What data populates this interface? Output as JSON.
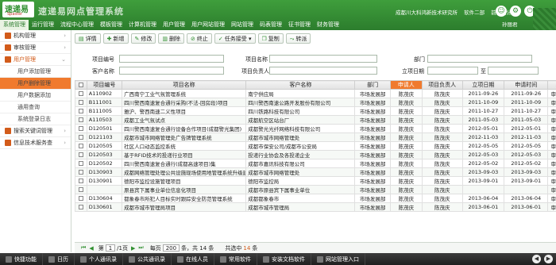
{
  "logo": {
    "brand": "速递易",
    "sub": "Spaster"
  },
  "app": {
    "title": "速递易网点管理系统",
    "company": "成都川大科鸿新技术研究所",
    "dept": "软件二部",
    "role": "前端设计",
    "user": "孙丽君"
  },
  "menus": [
    "系统管理",
    "运行管理",
    "流程中心管理",
    "模板管理",
    "计算机管理",
    "用户管理",
    "用户网站管理",
    "网站管理",
    "码表管理",
    "征书管理",
    "财务管理"
  ],
  "sidebar": {
    "items": [
      {
        "label": "机构管理",
        "type": "group"
      },
      {
        "label": "审核管理",
        "type": "group"
      },
      {
        "label": "用户管理",
        "type": "group-open"
      },
      {
        "label": "用户添加管理",
        "type": "sub"
      },
      {
        "label": "用户删除管理",
        "type": "sub-selected"
      },
      {
        "label": "用户数据添加",
        "type": "sub"
      },
      {
        "label": "通用查询",
        "type": "sub"
      },
      {
        "label": "系统登录日志",
        "type": "sub"
      },
      {
        "label": "搜索关键词管理",
        "type": "group"
      },
      {
        "label": "信息技术服务查",
        "type": "group"
      }
    ]
  },
  "toolbar": {
    "buttons": [
      "详情",
      "新增",
      "修改",
      "删除",
      "终止",
      "任务接受",
      "复制",
      "转派"
    ]
  },
  "filters": {
    "project_no": "项目编号",
    "project_name": "项目名称",
    "dept": "部门",
    "customer": "客户名称",
    "owner": "项目负责人",
    "date": "立项日期",
    "to": "至"
  },
  "table": {
    "headers": [
      "项目编号",
      "项目名称",
      "客户名称",
      "部门",
      "申请人",
      "项目负责人",
      "立项日期",
      "申请时间",
      "状态"
    ],
    "rows": [
      [
        "A110902",
        "广西南宁工业气氛管理系统",
        "南宁供应局",
        "市场发展部",
        "陈茂庆",
        "陈茂庆",
        "2011-09-26",
        "2011-09-26",
        "审批通过"
      ],
      [
        "B111001",
        "四川警西南速复合通行采购(不法-回房段)项目",
        "四川警西南速公路开发股份有限公司",
        "市场发展部",
        "陈茂庆",
        "陈茂庆",
        "2011-10-09",
        "2011-10-09",
        "审批通过"
      ],
      [
        "B111005",
        "雅沪、警西南速二义性项目",
        "四川铁路科技有限公司",
        "市场发展部",
        "陈茂庆",
        "陈茂庆",
        "2011-10-27",
        "2011-10-27",
        "审批通过"
      ],
      [
        "A110503",
        "成都工业气氛试点",
        "成都航空区站台厂",
        "市场发展部",
        "陈茂庆",
        "陈茂庆",
        "2011-05-03",
        "2011-05-03",
        "审批通过"
      ],
      [
        "D120501",
        "四川警西南速复合通行设备合作项目(成都警光集团)",
        "成都警光光纤网络科技有限公司",
        "市场发展部",
        "陈茂庆",
        "陈茂庆",
        "2012-05-01",
        "2012-05-01",
        "审批通过"
      ],
      [
        "D121103",
        "成都市城市网络管理处广告牌管理系统",
        "成都市城市网络管理处",
        "市场发展部",
        "陈茂庆",
        "陈茂庆",
        "2012-11-03",
        "2012-11-03",
        "审批通过"
      ],
      [
        "D120505",
        "社区人口动态监控系统",
        "成都市保安公司/成都市公安局",
        "市场发展部",
        "陈茂庆",
        "陈茂庆",
        "2012-05-05",
        "2012-05-05",
        "审批通过"
      ],
      [
        "D120503",
        "基于RFID技术的投递行业项目",
        "投递行业协会及各投递企业",
        "市场发展部",
        "陈茂庆",
        "陈茂庆",
        "2012-05-03",
        "2012-05-03",
        "审批通过"
      ],
      [
        "D120502",
        "四川警西南速复合通行(成都高速项目)集",
        "成都市嘉讯科技有限公司",
        "市场发展部",
        "陈茂庆",
        "陈茂庆",
        "2012-05-02",
        "2012-05-02",
        "审批通过"
      ],
      [
        "D130903",
        "成都网络管理处理公共设施现场使用地管理系统升级建设项目",
        "成都市城市网络管理处",
        "市场发展部",
        "陈茂庆",
        "陈茂庆",
        "2013-09-03",
        "2013-09-03",
        "审批通过"
      ],
      [
        "D130901",
        "德阳市监控设施管理项目",
        "德阳市监控局",
        "市场发展部",
        "陈茂庆",
        "陈茂庆",
        "2013-09-01",
        "2013-09-01",
        "审批通过"
      ],
      [
        "",
        "原县宾下属事业单位信息化项目",
        "成都市原县宾下属事业单位",
        "市场发展部",
        "陈茂庆",
        "陈茂庆",
        "",
        "",
        "审批通过"
      ],
      [
        "D130604",
        "都象春市所犯人目标实时跟踪安全防范管理系统",
        "成都都象春市",
        "市场发展部",
        "陈茂庆",
        "陈茂庆",
        "2013-06-04",
        "2013-06-04",
        "审批通过"
      ],
      [
        "D130601",
        "成都市城市管理局项目",
        "成都市城市管理局",
        "市场发展部",
        "陈茂庆",
        "陈茂庆",
        "2013-06-01",
        "2013-06-01",
        "审批通过"
      ]
    ]
  },
  "pager": {
    "page": "1",
    "total_pages_label": "/1页",
    "per_page_label": "每页",
    "per_page": "200",
    "suffix": "条，共 14 条",
    "summary_prefix": "共选中",
    "selected": "14",
    "summary_suffix": "条"
  },
  "taskbar": [
    "快捷功能",
    "日历",
    "个人通讯录",
    "公共通讯录",
    "在线人员",
    "常用软件",
    "安装文档软件",
    "网站管理入口"
  ]
}
